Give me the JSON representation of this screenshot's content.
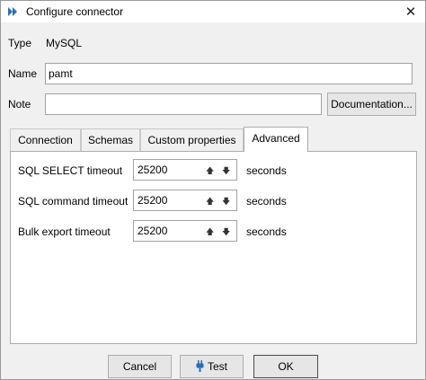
{
  "window": {
    "title": "Configure connector",
    "close_symbol": "✕"
  },
  "form": {
    "type_label": "Type",
    "type_value": "MySQL",
    "name_label": "Name",
    "name_value": "pamt",
    "note_label": "Note",
    "note_value": "",
    "documentation_button": "Documentation..."
  },
  "tabs": [
    {
      "label": "Connection",
      "active": false
    },
    {
      "label": "Schemas",
      "active": false
    },
    {
      "label": "Custom properties",
      "active": false
    },
    {
      "label": "Advanced",
      "active": true
    }
  ],
  "advanced": {
    "rows": [
      {
        "label": "SQL SELECT timeout",
        "value": "25200",
        "unit": "seconds"
      },
      {
        "label": "SQL command timeout",
        "value": "25200",
        "unit": "seconds"
      },
      {
        "label": "Bulk export timeout",
        "value": "25200",
        "unit": "seconds"
      }
    ],
    "up_symbol": "🡅",
    "down_symbol": "🡇"
  },
  "footer": {
    "cancel": "Cancel",
    "test": "Test",
    "ok": "OK"
  },
  "colors": {
    "accent": "#2a6db5",
    "dialog_bg": "#f0f0f0"
  },
  "icons": {
    "app": "connector-logo-icon",
    "test": "plug-icon",
    "close": "close-icon",
    "up": "arrow-up-icon",
    "down": "arrow-down-icon"
  }
}
